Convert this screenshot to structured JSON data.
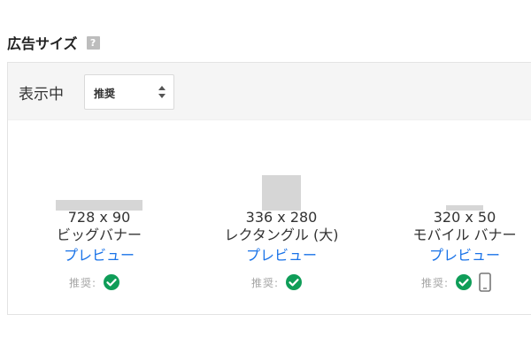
{
  "section": {
    "title": "広告サイズ",
    "help_icon": "?"
  },
  "toolbar": {
    "label": "表示中",
    "select_value": "推奨"
  },
  "ads": [
    {
      "size": "728 x 90",
      "name": "ビッグバナー",
      "preview": "プレビュー",
      "recommended_label": "推奨:"
    },
    {
      "size": "336 x 280",
      "name": "レクタングル (大)",
      "preview": "プレビュー",
      "recommended_label": "推奨:"
    },
    {
      "size": "320 x 50",
      "name": "モバイル バナー",
      "preview": "プレビュー",
      "recommended_label": "推奨:"
    }
  ],
  "colors": {
    "link": "#1a73e8",
    "check": "#0f9d58",
    "thumb": "#d6d6d6"
  }
}
